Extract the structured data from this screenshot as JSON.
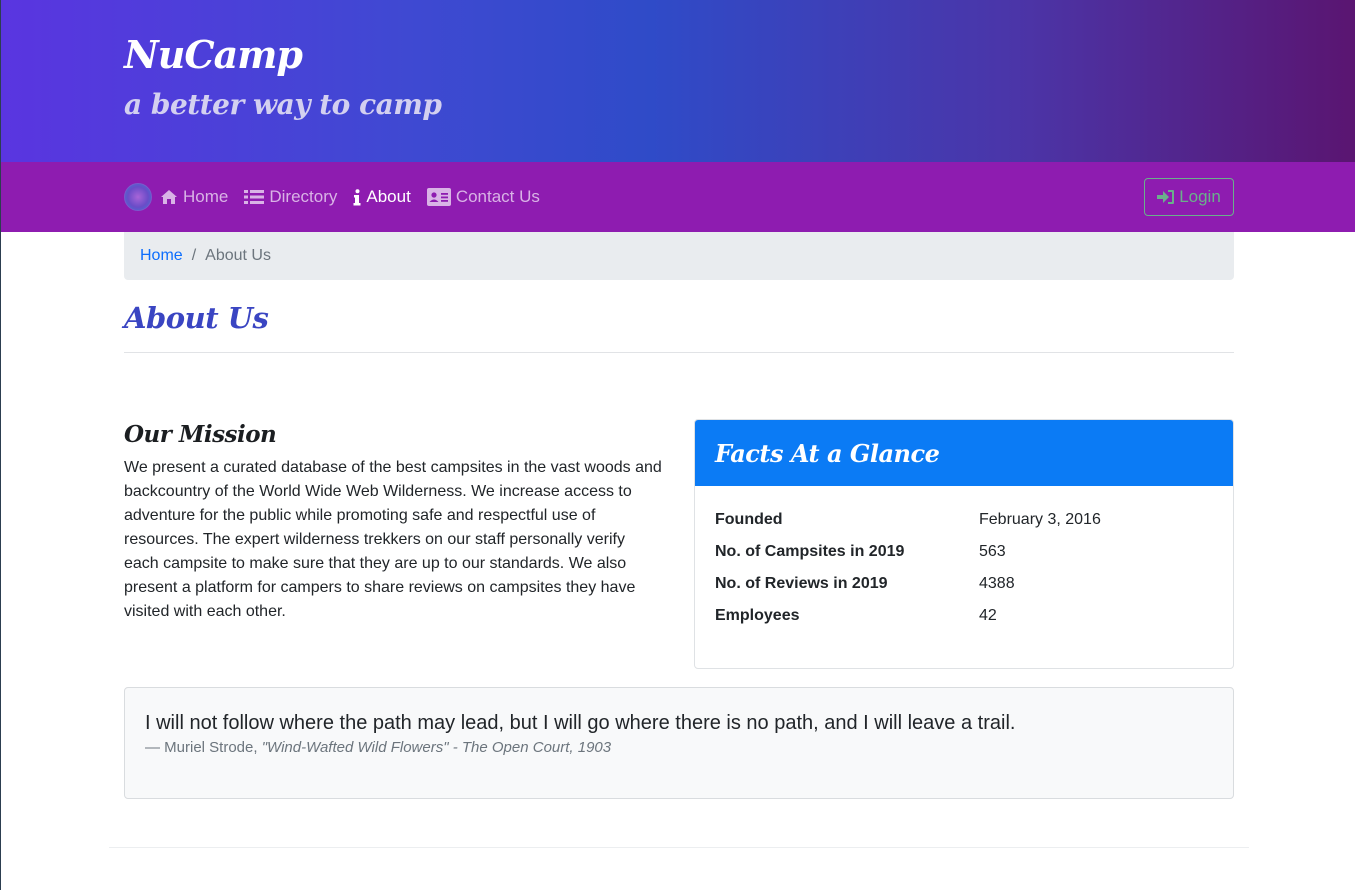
{
  "header": {
    "brand": "NuCamp",
    "tagline": "a better way to camp"
  },
  "nav": {
    "items": [
      {
        "label": "Home",
        "icon": "home-icon"
      },
      {
        "label": "Directory",
        "icon": "list-icon"
      },
      {
        "label": "About",
        "icon": "info-icon",
        "active": true
      },
      {
        "label": "Contact Us",
        "icon": "address-card-icon"
      }
    ],
    "login_label": "Login"
  },
  "breadcrumb": {
    "home": "Home",
    "separator": "/",
    "current": "About Us"
  },
  "page_title": "About Us",
  "mission": {
    "title": "Our Mission",
    "text": "We present a curated database of the best campsites in the vast woods and backcountry of the World Wide Web Wilderness. We increase access to adventure for the public while promoting safe and respectful use of resources. The expert wilderness trekkers on our staff personally verify each campsite to make sure that they are up to our standards. We also present a platform for campers to share reviews on campsites they have visited with each other."
  },
  "facts": {
    "title": "Facts At a Glance",
    "rows": [
      {
        "label": "Founded",
        "value": "February 3, 2016"
      },
      {
        "label": "No. of Campsites in 2019",
        "value": "563"
      },
      {
        "label": "No. of Reviews in 2019",
        "value": "4388"
      },
      {
        "label": "Employees",
        "value": "42"
      }
    ]
  },
  "quote": {
    "text": "I will not follow where the path may lead, but I will go where there is no path, and I will leave a trail.",
    "author": "— Muriel Strode, ",
    "source": "\"Wind-Wafted Wild Flowers\" - The Open Court, 1903"
  },
  "colors": {
    "nav_bg": "#8e1cb0",
    "card_header": "#0b7bf5",
    "title_accent": "#3a45c2"
  }
}
